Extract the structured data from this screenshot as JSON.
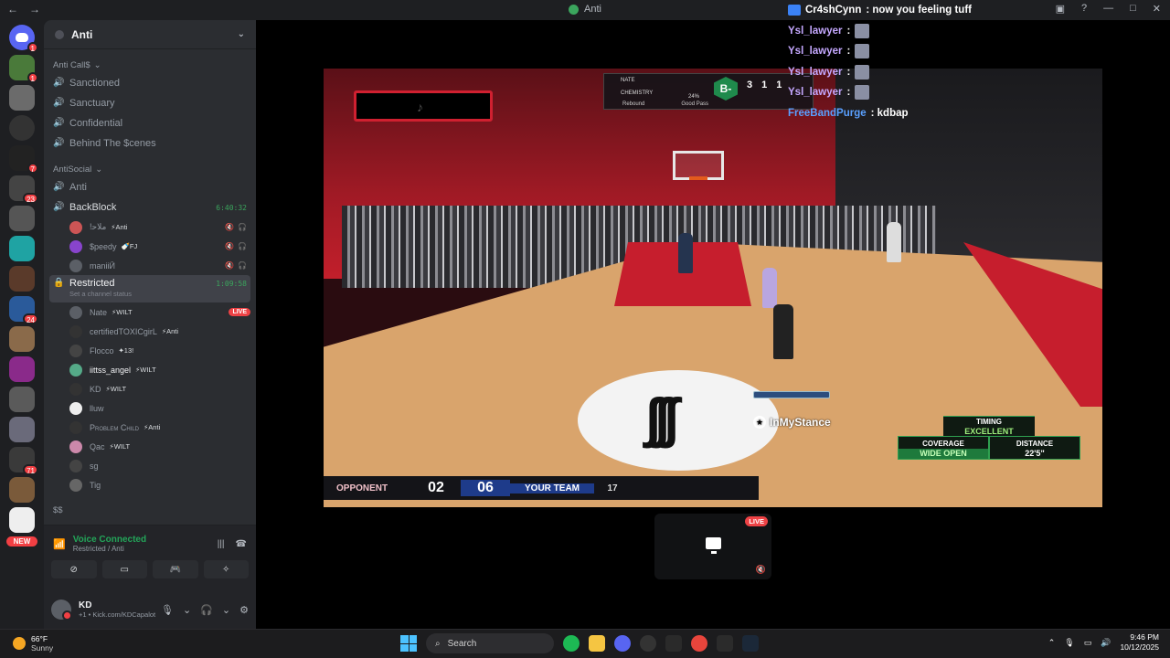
{
  "window": {
    "title": "Anti"
  },
  "server": {
    "name": "Anti"
  },
  "categories": {
    "anticalls": "Anti Call$",
    "antisocial": "AntiSocial",
    "last": "$$"
  },
  "channels_a": [
    "Sanctioned",
    "Sanctuary",
    "Confidential",
    "Behind The $cenes"
  ],
  "channel_anti": "Anti",
  "backblock": {
    "label": "BackBlock",
    "time": "6:40:32"
  },
  "backblock_users": [
    {
      "name": "!ﻣﻼﺣ",
      "tag": "⚡Anti"
    },
    {
      "name": "$peedy",
      "tag": "🍼FJ"
    },
    {
      "name": "maniiӢ",
      "tag": ""
    }
  ],
  "restricted": {
    "label": "Restricted",
    "time": "1:09:58",
    "status": "Set a channel status"
  },
  "restricted_users": [
    {
      "name": "Nate",
      "tag": "⚡WILT",
      "live": "LIVE"
    },
    {
      "name": "certifiedTOXICgirL",
      "tag": "⚡Anti",
      "live": ""
    },
    {
      "name": "Flocco",
      "tag": "✦13!",
      "live": ""
    },
    {
      "name": "iittss_angel",
      "tag": "⚡WILT",
      "live": ""
    },
    {
      "name": "KD",
      "tag": "⚡WILT",
      "live": ""
    },
    {
      "name": "lluw",
      "tag": "",
      "live": ""
    },
    {
      "name": "Problem Child",
      "tag": "⚡Anti",
      "live": ""
    },
    {
      "name": "Qac",
      "tag": "⚡WILT",
      "live": ""
    },
    {
      "name": "sg",
      "tag": "",
      "live": ""
    },
    {
      "name": "Tig",
      "tag": "",
      "live": ""
    }
  ],
  "voice": {
    "status": "Voice Connected",
    "location": "Restricted / Anti"
  },
  "user": {
    "name": "KD",
    "status": "+1 • Kick.com/KDCapalot"
  },
  "servers": {
    "badges": [
      "1",
      "1",
      "",
      "",
      "7",
      "23",
      "",
      "",
      "",
      "24",
      "",
      "",
      "",
      "",
      "71",
      "",
      ""
    ],
    "new_label": "NEW"
  },
  "chat": [
    {
      "name": "Cr4shCynn",
      "msg": ": now you feeling tuff"
    },
    {
      "name": "Ysl_lawyer",
      "msg": ":"
    },
    {
      "name": "Ysl_lawyer",
      "msg": ":"
    },
    {
      "name": "Ysl_lawyer",
      "msg": ":"
    },
    {
      "name": "Ysl_lawyer",
      "msg": ":"
    },
    {
      "name": "FreeBandPurge",
      "msg": ": kdbap"
    }
  ],
  "game": {
    "hud": {
      "player": "NATE",
      "chem": "CHEMISTRY",
      "pct": "24%",
      "grade": "B-",
      "pts": "3",
      "reb": "1",
      "ast": "1",
      "foot1": "Rebound",
      "foot2": "Good Pass"
    },
    "scoreboard": {
      "opponent": "OPPONENT",
      "opp_score": "02",
      "my_score": "06",
      "my_team": "YOUR TEAM",
      "clock": "17"
    },
    "stance": "InMyStance",
    "feedback": {
      "timing_label": "TIMING",
      "timing": "EXCELLENT",
      "coverage_label": "COVERAGE",
      "coverage": "WIDE OPEN",
      "distance_label": "DISTANCE",
      "distance": "22'5\""
    }
  },
  "stream_tile": {
    "live": "LIVE"
  },
  "taskbar": {
    "temp": "66°F",
    "weather": "Sunny",
    "search": "Search",
    "time": "9:46 PM",
    "date": "10/12/2025"
  }
}
